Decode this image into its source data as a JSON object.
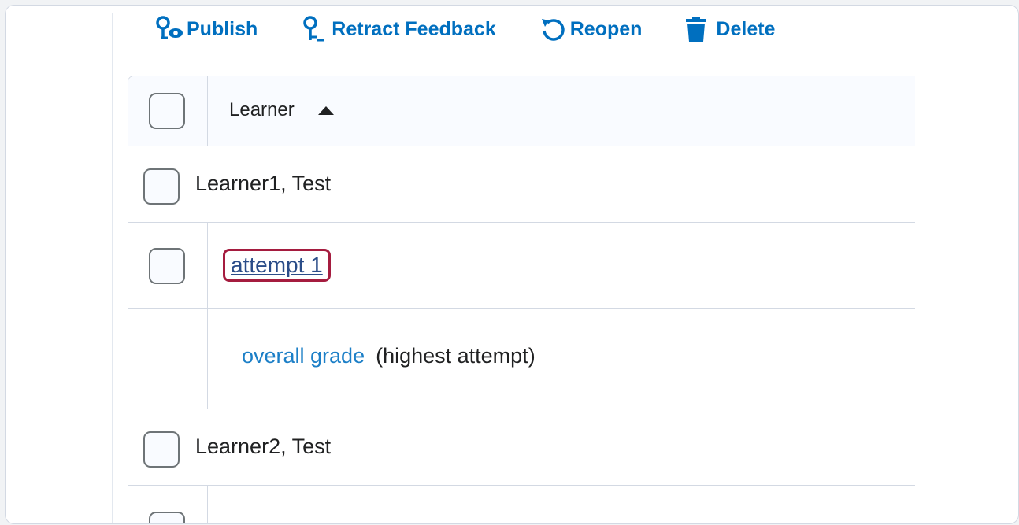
{
  "toolbar": {
    "publish": {
      "label": "Publish",
      "icon": "publish-icon"
    },
    "retract": {
      "label": "Retract Feedback",
      "icon": "retract-feedback-icon"
    },
    "reopen": {
      "label": "Reopen",
      "icon": "reopen-icon"
    },
    "delete": {
      "label": "Delete",
      "icon": "trash-icon"
    }
  },
  "table": {
    "header": {
      "column": "Learner",
      "sort": "ascending"
    },
    "rows": [
      {
        "type": "learner",
        "name": "Learner1, Test"
      },
      {
        "type": "attempt",
        "label": "attempt 1"
      },
      {
        "type": "overall",
        "link": "overall grade",
        "note": "(highest attempt)"
      },
      {
        "type": "learner",
        "name": "Learner2, Test"
      }
    ]
  },
  "colors": {
    "accent": "#006fbf",
    "link": "#1c7fc7",
    "highlight": "#a51c3f"
  }
}
